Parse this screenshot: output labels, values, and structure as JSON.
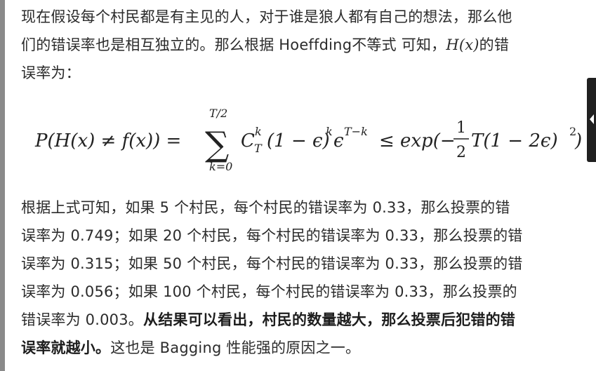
{
  "paragraph1": {
    "line1": "现在假设每个村民都是有主见的人，对于谁是狼人都有自己的想法，那么他",
    "line2_pre": "们的错误率也是相互独立的。那么根据 Hoeffding不等式 可知，",
    "line2_math": "H(x)",
    "line2_post": "的错",
    "line3": "误率为："
  },
  "formula": {
    "lhs": "P(H(x) ≠ f(x)) =",
    "sum_upper": "T/2",
    "sum_lower": "k=0",
    "sum_symbol": "∑",
    "term_C": "C",
    "term_C_sup": "k",
    "term_C_sub": "T",
    "term_mid": "(1 − ϵ)",
    "term_mid_sup": "k",
    "term_eps": "ϵ",
    "term_eps_sup": "T−k",
    "rel": "≤",
    "rhs_pre": "exp(−",
    "frac_num": "1",
    "frac_den": "2",
    "rhs_post": "T(1 − 2ϵ)",
    "rhs_sup": "2",
    "rhs_close": ")"
  },
  "paragraph2": {
    "line1": "根据上式可知，如果 5 个村民，每个村民的错误率为 0.33，那么投票的错",
    "line2": "误率为 0.749；如果 20 个村民，每个村民的错误率为 0.33，那么投票的错",
    "line3": "误率为 0.315；如果 50 个村民，每个村民的错误率为 0.33，那么投票的错",
    "line4": "误率为 0.056；如果 100 个村民，每个村民的错误率为 0.33，那么投票的",
    "line5_pre": "错误率为 0.003。",
    "line5_bold": "从结果可以看出，村民的数量越大，那么投票后犯错的错",
    "line6_bold": "误率就越小。",
    "line6_post": "这也是 Bagging 性能强的原因之一。"
  }
}
